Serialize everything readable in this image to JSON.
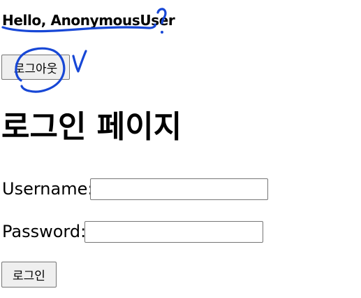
{
  "header": {
    "greeting": "Hello, AnonymousUser"
  },
  "logout": {
    "label": "로그아웃"
  },
  "page": {
    "title": "로그인 페이지"
  },
  "form": {
    "username_label": "Username:",
    "username_value": "",
    "password_label": "Password:",
    "password_value": "",
    "submit_label": "로그인"
  },
  "annotation": {
    "ink_color": "#1747d6"
  }
}
